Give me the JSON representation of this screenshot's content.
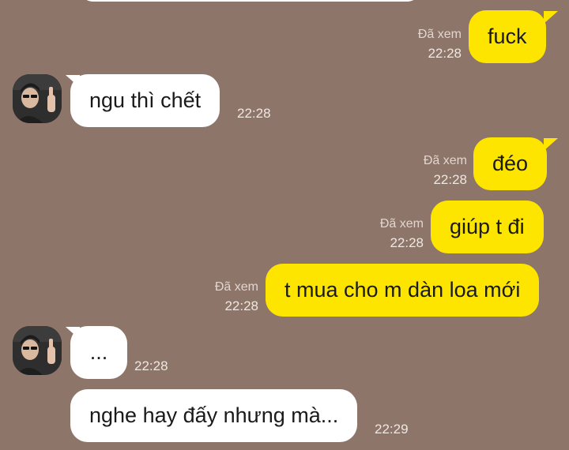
{
  "colors": {
    "background": "#8e7569",
    "outgoing_bubble": "#fee500",
    "incoming_bubble": "#ffffff",
    "meta_text": "#efe7e1"
  },
  "messages": [
    {
      "direction": "outgoing",
      "text": "fuck",
      "read_label": "Đã xem",
      "time": "22:28"
    },
    {
      "direction": "incoming",
      "text": "ngu thì chết",
      "time": "22:28",
      "has_avatar": true
    },
    {
      "direction": "outgoing",
      "text": "đéo",
      "read_label": "Đã xem",
      "time": "22:28"
    },
    {
      "direction": "outgoing",
      "text": "giúp t đi",
      "read_label": "Đã xem",
      "time": "22:28"
    },
    {
      "direction": "outgoing",
      "text": "t mua cho m dàn loa mới",
      "read_label": "Đã xem",
      "time": "22:28"
    },
    {
      "direction": "incoming",
      "text": "...",
      "time": "22:28",
      "has_avatar": true
    },
    {
      "direction": "incoming",
      "text": "nghe hay đấy nhưng mà...",
      "time": "22:29",
      "has_avatar": false
    }
  ]
}
